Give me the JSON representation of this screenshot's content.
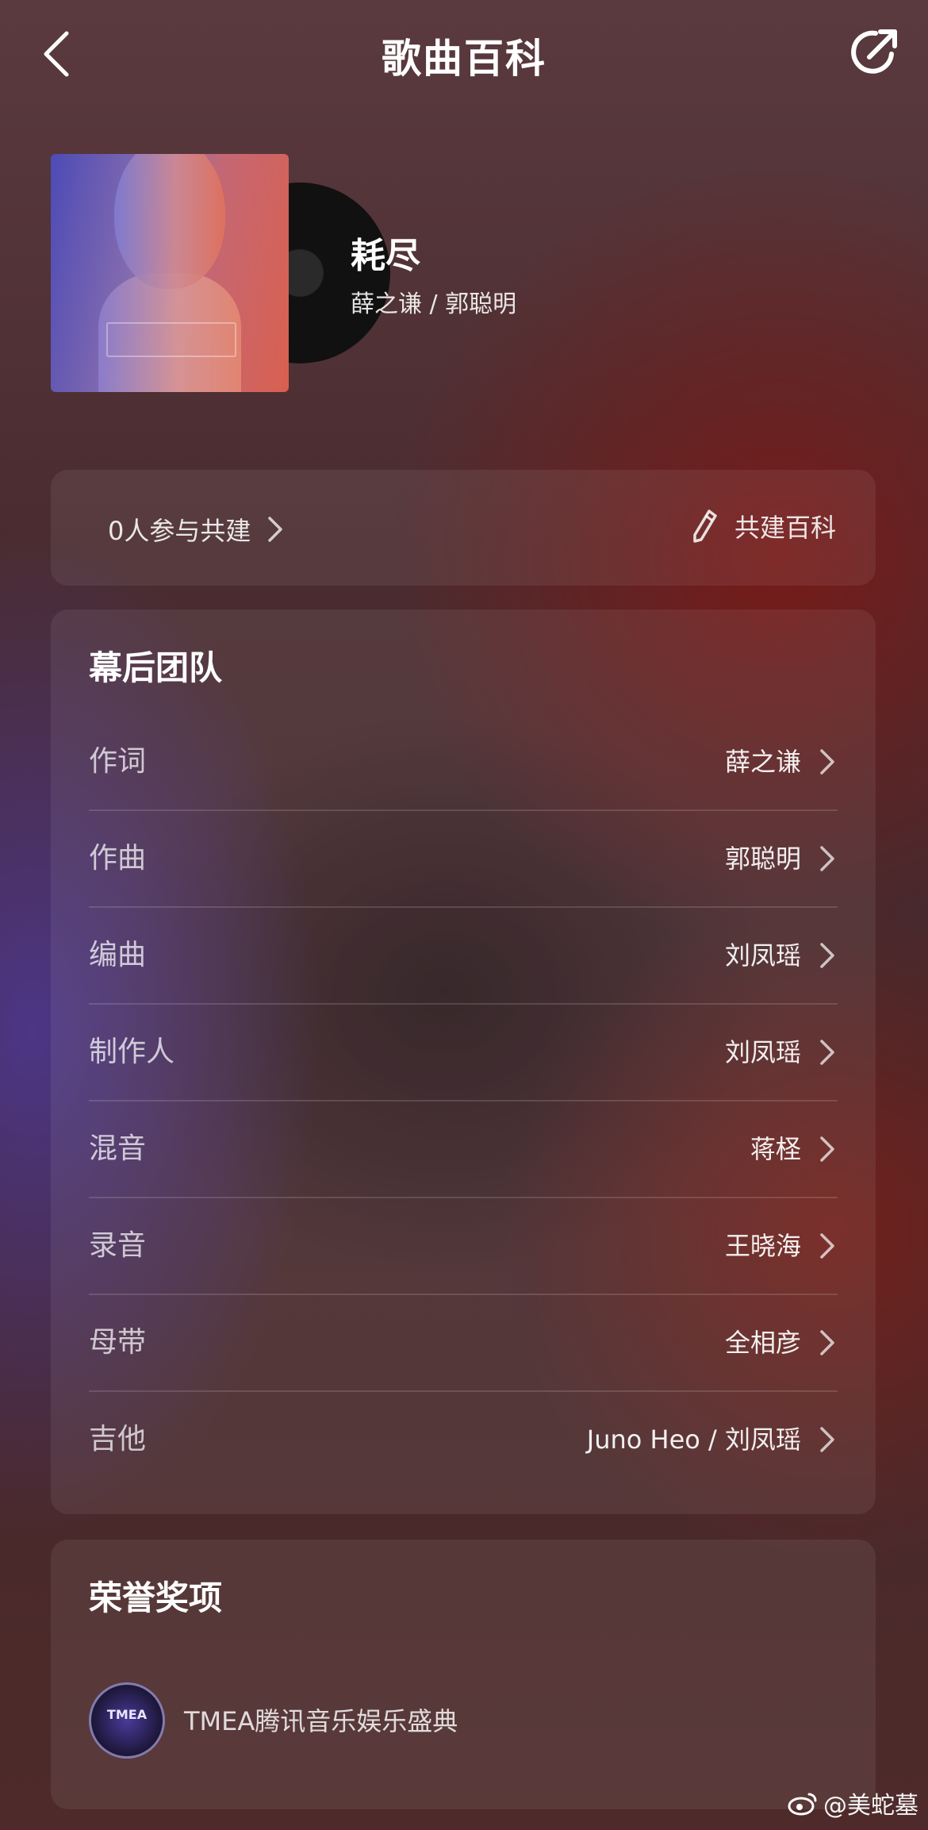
{
  "header": {
    "title": "歌曲百科"
  },
  "song": {
    "name": "耗尽",
    "artists": "薛之谦 / 郭聪明"
  },
  "contribute": {
    "participants": "0人参与共建",
    "action": "共建百科"
  },
  "team": {
    "title": "幕后团队",
    "rows": [
      {
        "role": "作词",
        "name": "薛之谦"
      },
      {
        "role": "作曲",
        "name": "郭聪明"
      },
      {
        "role": "编曲",
        "name": "刘凤瑶"
      },
      {
        "role": "制作人",
        "name": "刘凤瑶"
      },
      {
        "role": "混音",
        "name": "蒋柽"
      },
      {
        "role": "录音",
        "name": "王晓海"
      },
      {
        "role": "母带",
        "name": "全相彦"
      },
      {
        "role": "吉他",
        "name": "Juno Heo / 刘凤瑶"
      }
    ]
  },
  "awards": {
    "title": "荣誉奖项",
    "items": [
      {
        "badge": "TMEA",
        "name": "TMEA腾讯音乐娱乐盛典"
      }
    ]
  },
  "watermark": {
    "text": "@美蛇墓"
  },
  "icons": {
    "back": "chevron-left-icon",
    "share": "share-arrow-icon",
    "edit": "pencil-icon",
    "row": "chevron-right-icon",
    "weibo": "weibo-logo-icon"
  }
}
